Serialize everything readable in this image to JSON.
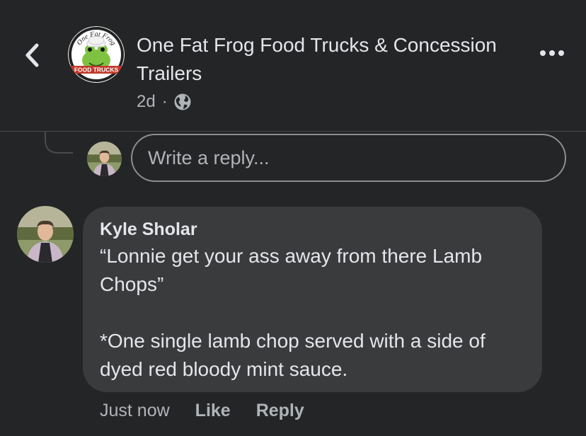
{
  "header": {
    "page_name": "One Fat Frog Food Trucks & Concession Trailers",
    "post_age": "2d",
    "separator": "·",
    "audience_icon": "globe-icon",
    "back_icon": "chevron-left-icon",
    "more_icon": "more-horizontal-icon",
    "logo": {
      "top_text": "One Fat Frog",
      "banner_text": "FOOD TRUCKS"
    }
  },
  "reply_box": {
    "placeholder": "Write a reply..."
  },
  "comment": {
    "author": "Kyle Sholar",
    "lines": [
      "“Lonnie get your ass away from there Lamb Chops”",
      "",
      "*One single lamb chop served with a side of dyed red bloody mint sauce."
    ],
    "timestamp": "Just now",
    "like_label": "Like",
    "reply_label": "Reply"
  },
  "colors": {
    "background": "#242526",
    "bubble": "#3a3b3c",
    "primary_text": "#e4e6eb",
    "secondary_text": "#b0b3b8"
  }
}
